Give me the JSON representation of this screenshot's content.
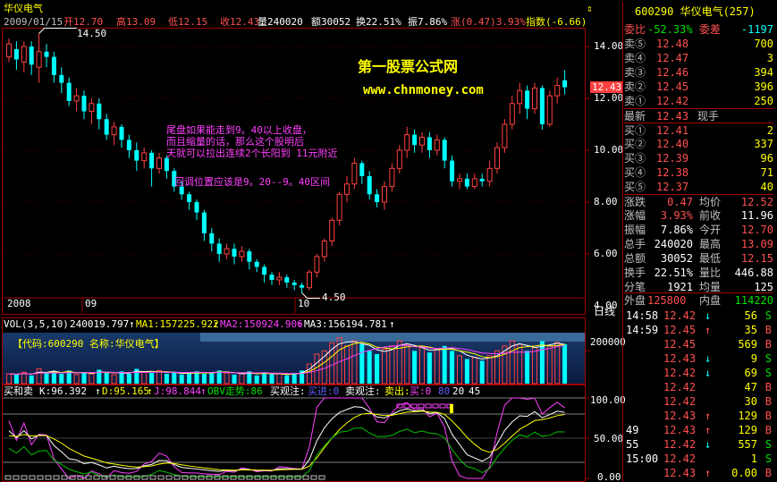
{
  "stock": {
    "name": "华仪电气",
    "code": "600290",
    "code_name": "600290  华仪电气(257)"
  },
  "header": {
    "date": "2009/01/15",
    "open": "开12.70",
    "high": "高13.09",
    "low": "低12.15",
    "close": "收12.43",
    "volume": "量240020",
    "amount": "额30052",
    "turnover": "换22.51%",
    "amplitude": "振7.86%",
    "change": "涨(0.47)3.93%",
    "index": "指数(-6.66)"
  },
  "watermark": {
    "title": "第一股票公式网",
    "url": "www.chnmoney.com"
  },
  "annotations": {
    "line1": "尾盘如果能走到9。40以上收盘，",
    "line2": "而且缩量的话，那么这个股明后",
    "line3": "天就可以拉出连续2个长阳到 11元附近",
    "line4": "回调位置应该是9。20--9。40区间"
  },
  "price_chart": {
    "high_label": "14.50",
    "low_label": "4.50",
    "current_price_tag": "12.43",
    "y_ticks": [
      "14.00",
      "12.00",
      "10.00",
      "8.00",
      "6.00",
      "4.00"
    ],
    "x_labels": [
      "2008",
      "09",
      "10"
    ],
    "period": "日线",
    "candles": [
      [
        13.6,
        14.1,
        13.4,
        14.3
      ],
      [
        13.9,
        13.5,
        13.1,
        14.2
      ],
      [
        13.4,
        14.0,
        13.0,
        14.2
      ],
      [
        14.0,
        13.3,
        12.9,
        14.2
      ],
      [
        13.2,
        13.8,
        12.6,
        14.5
      ],
      [
        13.8,
        13.6,
        13.2,
        14.1
      ],
      [
        13.6,
        12.9,
        12.6,
        13.8
      ],
      [
        12.9,
        12.6,
        12.2,
        13.2
      ],
      [
        12.6,
        11.9,
        11.7,
        12.8
      ],
      [
        11.9,
        12.1,
        11.5,
        12.4
      ],
      [
        12.1,
        11.5,
        11.2,
        12.3
      ],
      [
        11.5,
        11.8,
        11.0,
        12.0
      ],
      [
        11.8,
        11.2,
        10.8,
        12.0
      ],
      [
        11.2,
        10.6,
        10.4,
        11.4
      ],
      [
        10.6,
        10.9,
        10.2,
        11.1
      ],
      [
        10.9,
        10.4,
        10.1,
        11.0
      ],
      [
        10.4,
        10.0,
        9.7,
        10.6
      ],
      [
        10.0,
        9.6,
        9.2,
        10.3
      ],
      [
        9.6,
        9.9,
        9.3,
        10.1
      ],
      [
        9.9,
        9.3,
        8.6,
        10.0
      ],
      [
        9.3,
        9.7,
        9.1,
        9.9
      ],
      [
        9.7,
        9.2,
        8.9,
        9.8
      ],
      [
        9.2,
        8.6,
        8.4,
        9.3
      ],
      [
        8.6,
        8.3,
        8.1,
        8.8
      ],
      [
        8.3,
        8.0,
        7.7,
        8.4
      ],
      [
        8.0,
        7.6,
        7.3,
        8.1
      ],
      [
        7.6,
        6.8,
        6.5,
        7.7
      ],
      [
        6.8,
        6.4,
        6.1,
        7.0
      ],
      [
        6.4,
        6.0,
        5.7,
        6.6
      ],
      [
        6.0,
        6.2,
        5.8,
        6.4
      ],
      [
        6.2,
        5.9,
        5.6,
        6.4
      ],
      [
        5.9,
        6.1,
        5.7,
        6.3
      ],
      [
        6.1,
        5.7,
        5.4,
        6.2
      ],
      [
        5.7,
        5.5,
        5.3,
        5.8
      ],
      [
        5.5,
        5.2,
        4.9,
        5.6
      ],
      [
        5.2,
        5.0,
        4.8,
        5.3
      ],
      [
        5.0,
        5.1,
        4.8,
        5.3
      ],
      [
        5.1,
        4.9,
        4.7,
        5.2
      ],
      [
        4.9,
        4.8,
        4.6,
        5.0
      ],
      [
        4.8,
        4.7,
        4.5,
        4.9
      ],
      [
        4.7,
        5.3,
        4.6,
        5.4
      ],
      [
        5.3,
        5.9,
        5.1,
        6.0
      ],
      [
        5.9,
        6.5,
        5.7,
        6.6
      ],
      [
        6.5,
        7.3,
        6.3,
        7.4
      ],
      [
        7.3,
        8.3,
        7.1,
        8.4
      ],
      [
        8.3,
        8.7,
        8.0,
        9.0
      ],
      [
        8.7,
        9.5,
        8.5,
        9.7
      ],
      [
        9.5,
        9.0,
        8.7,
        9.6
      ],
      [
        9.0,
        8.3,
        8.1,
        9.2
      ],
      [
        8.3,
        8.0,
        7.8,
        8.5
      ],
      [
        8.0,
        8.6,
        7.7,
        8.8
      ],
      [
        8.6,
        9.3,
        8.4,
        9.5
      ],
      [
        9.3,
        10.0,
        9.1,
        10.2
      ],
      [
        10.0,
        10.6,
        9.7,
        10.9
      ],
      [
        10.6,
        10.2,
        9.9,
        10.8
      ],
      [
        10.2,
        10.5,
        9.9,
        10.7
      ],
      [
        10.5,
        10.0,
        9.7,
        10.7
      ],
      [
        10.0,
        10.4,
        9.8,
        10.6
      ],
      [
        10.4,
        9.6,
        9.3,
        10.5
      ],
      [
        9.6,
        8.8,
        8.6,
        9.8
      ],
      [
        8.8,
        8.9,
        8.5,
        9.1
      ],
      [
        8.9,
        8.6,
        8.5,
        9.1
      ],
      [
        8.6,
        8.9,
        8.5,
        9.1
      ],
      [
        8.9,
        8.8,
        8.6,
        9.1
      ],
      [
        8.8,
        9.3,
        8.6,
        9.6
      ],
      [
        9.3,
        10.1,
        9.1,
        10.3
      ],
      [
        10.1,
        11.0,
        9.9,
        11.2
      ],
      [
        11.0,
        11.8,
        10.8,
        12.1
      ],
      [
        11.8,
        12.3,
        11.4,
        12.6
      ],
      [
        12.3,
        11.6,
        11.2,
        12.5
      ],
      [
        11.6,
        12.4,
        11.4,
        12.6
      ],
      [
        12.4,
        11.0,
        10.8,
        12.5
      ],
      [
        11.0,
        12.1,
        10.9,
        12.3
      ],
      [
        12.1,
        12.5,
        11.8,
        12.8
      ],
      [
        12.7,
        12.43,
        12.15,
        13.09
      ]
    ]
  },
  "volume_panel": {
    "title": "VOL(3,5,10)",
    "vol": "240019.797",
    "ma1": "MA1:157225.922",
    "ma2": "MA2:150924.906",
    "ma3": "MA3:156194.781",
    "info": "【代码:600290  名称:华仪电气】",
    "y_tick": "200000",
    "values": [
      60,
      55,
      70,
      50,
      90,
      65,
      75,
      60,
      80,
      55,
      70,
      60,
      85,
      65,
      55,
      75,
      60,
      90,
      70,
      65,
      80,
      60,
      70,
      55,
      65,
      75,
      60,
      70,
      80,
      65,
      55,
      60,
      75,
      50,
      70,
      55,
      60,
      50,
      65,
      80,
      120,
      180,
      200,
      250,
      280,
      230,
      260,
      240,
      200,
      180,
      210,
      230,
      260,
      240,
      200,
      220,
      190,
      210,
      230,
      200,
      170,
      150,
      160,
      140,
      170,
      200,
      230,
      260,
      240,
      200,
      220,
      260,
      230,
      250,
      240
    ]
  },
  "indicator_panel": {
    "title": "买和卖",
    "k": "K:96.392",
    "d": "D:95.165",
    "j": "J:98.844",
    "obv": "OBV走势:86",
    "buy_watch": "买观注:",
    "buy_in": "买进:0",
    "sell_watch": "卖观注:",
    "sell_out": "卖出:",
    "buy": "买:0",
    "v80": "80",
    "v20": "20",
    "v45": "45",
    "y_ticks": [
      "100.00",
      "50.00",
      "0.00"
    ]
  },
  "orderbook": {
    "webi": {
      "label": "委比",
      "value": "-52.33%",
      "diff_label": "委差",
      "diff": "-1197"
    },
    "sells": [
      {
        "label": "卖⑤",
        "price": "12.48",
        "vol": "700"
      },
      {
        "label": "卖④",
        "price": "12.47",
        "vol": "3"
      },
      {
        "label": "卖③",
        "price": "12.46",
        "vol": "394"
      },
      {
        "label": "卖②",
        "price": "12.45",
        "vol": "396"
      },
      {
        "label": "卖①",
        "price": "12.42",
        "vol": "250"
      }
    ],
    "latest": {
      "label": "最新",
      "price": "12.43",
      "hand": "现手"
    },
    "buys": [
      {
        "label": "买①",
        "price": "12.41",
        "vol": "2"
      },
      {
        "label": "买②",
        "price": "12.40",
        "vol": "337"
      },
      {
        "label": "买③",
        "price": "12.39",
        "vol": "96"
      },
      {
        "label": "买④",
        "price": "12.38",
        "vol": "71"
      },
      {
        "label": "买⑤",
        "price": "12.37",
        "vol": "40"
      }
    ],
    "stats": [
      {
        "l1": "涨跌",
        "v1": "0.47",
        "l2": "均价",
        "v2": "12.52"
      },
      {
        "l1": "涨幅",
        "v1": "3.93%",
        "l2": "前收",
        "v2": "11.96"
      },
      {
        "l1": "振幅",
        "v1": "7.86%",
        "l2": "今开",
        "v2": "12.70"
      },
      {
        "l1": "总手",
        "v1": "240020",
        "l2": "最高",
        "v2": "13.09"
      },
      {
        "l1": "总额",
        "v1": "30052",
        "l2": "最低",
        "v2": "12.15"
      },
      {
        "l1": "换手",
        "v1": "22.51%",
        "l2": "量比",
        "v2": "446.88"
      },
      {
        "l1": "分笔",
        "v1": "1921",
        "l2": "均量",
        "v2": "125"
      }
    ],
    "outer": {
      "label": "外盘",
      "value": "125800",
      "inner_label": "内盘",
      "inner": "114220"
    }
  },
  "ticks": [
    {
      "time": "14:58",
      "price": "12.42",
      "arrow": "↓",
      "vol": "56",
      "side": "S"
    },
    {
      "time": "14:59",
      "price": "12.45",
      "arrow": "↑",
      "vol": "35",
      "side": "B"
    },
    {
      "time": "",
      "price": "12.45",
      "arrow": "",
      "vol": "569",
      "side": "B"
    },
    {
      "time": "",
      "price": "12.43",
      "arrow": "↓",
      "vol": "9",
      "side": "S"
    },
    {
      "time": "",
      "price": "12.42",
      "arrow": "↓",
      "vol": "69",
      "side": "S"
    },
    {
      "time": "",
      "price": "12.42",
      "arrow": "",
      "vol": "47",
      "side": "B"
    },
    {
      "time": "",
      "price": "12.42",
      "arrow": "",
      "vol": "30",
      "side": "B"
    },
    {
      "time": "",
      "price": "12.43",
      "arrow": "↑",
      "vol": "129",
      "side": "B"
    },
    {
      "time": "49",
      "price": "12.43",
      "arrow": "↑",
      "vol": "129",
      "side": "B"
    },
    {
      "time": "55",
      "price": "12.42",
      "arrow": "↓",
      "vol": "557",
      "side": "S"
    },
    {
      "time": "15:00",
      "price": "12.42",
      "arrow": "",
      "vol": "1",
      "side": "S"
    },
    {
      "time": "",
      "price": "12.43",
      "arrow": "↑",
      "vol": "0.00",
      "side": "B"
    }
  ],
  "colors": {
    "up": "#ff4040",
    "down": "#00ffff",
    "border": "#a00000",
    "bg": "#000000"
  }
}
